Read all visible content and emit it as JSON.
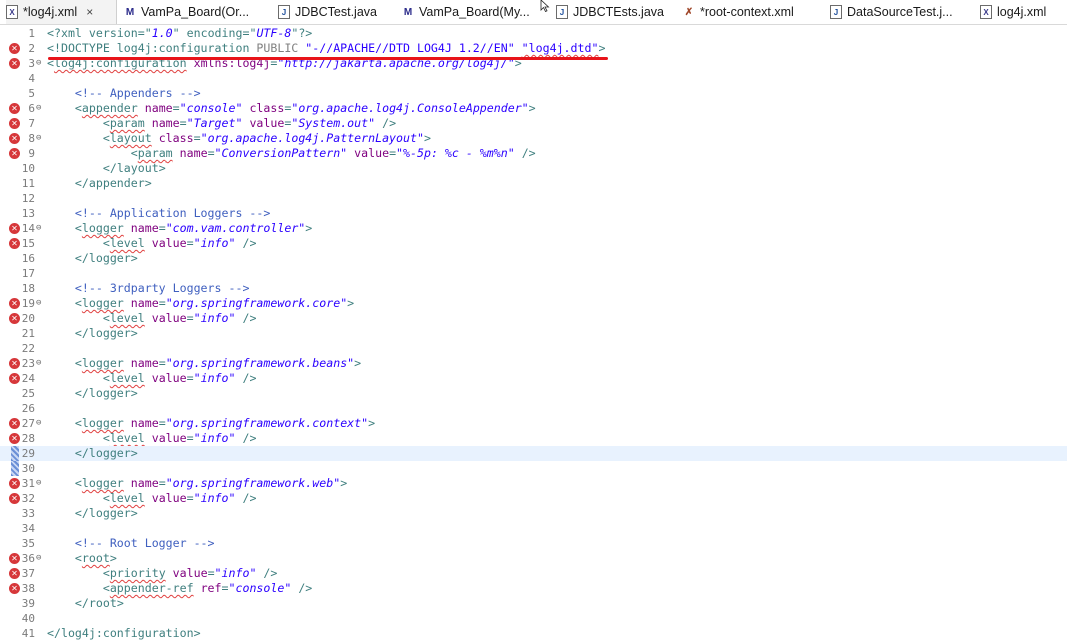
{
  "tabs": [
    {
      "label": "*log4j.xml",
      "icon": "xml-file-icon",
      "active": true,
      "closable": true
    },
    {
      "label": "VamPa_Board(Or...",
      "icon": "mybatis-mapper-icon"
    },
    {
      "label": "JDBCTest.java",
      "icon": "java-file-icon"
    },
    {
      "label": "VamPa_Board(My...",
      "icon": "mybatis-mapper-icon"
    },
    {
      "label": "JDBCTEsts.java",
      "icon": "java-file-icon"
    },
    {
      "label": "*root-context.xml",
      "icon": "spring-context-icon"
    },
    {
      "label": "DataSourceTest.j...",
      "icon": "java-file-icon"
    },
    {
      "label": "log4j.xml",
      "icon": "xml-file-icon"
    }
  ],
  "tab_close_glyph": "×",
  "lines": [
    {
      "n": "1",
      "text": "<?xml version=\"1.0\" encoding=\"UTF-8\"?>"
    },
    {
      "n": "2",
      "text": "<!DOCTYPE log4j:configuration PUBLIC \"-//APACHE//DTD LOG4J 1.2//EN\" \"log4j.dtd\">",
      "error": true
    },
    {
      "n": "3",
      "text": "<log4j:configuration xmlns:log4j=\"http://jakarta.apache.org/log4j/\">",
      "error": true,
      "fold": true
    },
    {
      "n": "4",
      "text": ""
    },
    {
      "n": "5",
      "text": "    <!-- Appenders -->"
    },
    {
      "n": "6",
      "text": "    <appender name=\"console\" class=\"org.apache.log4j.ConsoleAppender\">",
      "error": true,
      "fold": true
    },
    {
      "n": "7",
      "text": "        <param name=\"Target\" value=\"System.out\" />",
      "error": true
    },
    {
      "n": "8",
      "text": "        <layout class=\"org.apache.log4j.PatternLayout\">",
      "error": true,
      "fold": true
    },
    {
      "n": "9",
      "text": "            <param name=\"ConversionPattern\" value=\"%-5p: %c - %m%n\" />",
      "error": true
    },
    {
      "n": "10",
      "text": "        </layout>"
    },
    {
      "n": "11",
      "text": "    </appender>"
    },
    {
      "n": "12",
      "text": ""
    },
    {
      "n": "13",
      "text": "    <!-- Application Loggers -->"
    },
    {
      "n": "14",
      "text": "    <logger name=\"com.vam.controller\">",
      "error": true,
      "fold": true
    },
    {
      "n": "15",
      "text": "        <level value=\"info\" />",
      "error": true
    },
    {
      "n": "16",
      "text": "    </logger>"
    },
    {
      "n": "17",
      "text": ""
    },
    {
      "n": "18",
      "text": "    <!-- 3rdparty Loggers -->"
    },
    {
      "n": "19",
      "text": "    <logger name=\"org.springframework.core\">",
      "error": true,
      "fold": true
    },
    {
      "n": "20",
      "text": "        <level value=\"info\" />",
      "error": true
    },
    {
      "n": "21",
      "text": "    </logger>"
    },
    {
      "n": "22",
      "text": ""
    },
    {
      "n": "23",
      "text": "    <logger name=\"org.springframework.beans\">",
      "error": true,
      "fold": true
    },
    {
      "n": "24",
      "text": "        <level value=\"info\" />",
      "error": true
    },
    {
      "n": "25",
      "text": "    </logger>"
    },
    {
      "n": "26",
      "text": ""
    },
    {
      "n": "27",
      "text": "    <logger name=\"org.springframework.context\">",
      "error": true,
      "fold": true
    },
    {
      "n": "28",
      "text": "        <level value=\"info\" />",
      "error": true
    },
    {
      "n": "29",
      "text": "    </logger>",
      "highlight": true,
      "changed": true
    },
    {
      "n": "30",
      "text": "",
      "changed": true
    },
    {
      "n": "31",
      "text": "    <logger name=\"org.springframework.web\">",
      "error": true,
      "fold": true
    },
    {
      "n": "32",
      "text": "        <level value=\"info\" />",
      "error": true
    },
    {
      "n": "33",
      "text": "    </logger>"
    },
    {
      "n": "34",
      "text": ""
    },
    {
      "n": "35",
      "text": "    <!-- Root Logger -->"
    },
    {
      "n": "36",
      "text": "    <root>",
      "error": true,
      "fold": true
    },
    {
      "n": "37",
      "text": "        <priority value=\"info\" />",
      "error": true
    },
    {
      "n": "38",
      "text": "        <appender-ref ref=\"console\" />",
      "error": true
    },
    {
      "n": "39",
      "text": "    </root>"
    },
    {
      "n": "40",
      "text": ""
    },
    {
      "n": "41",
      "text": "</log4j:configuration>"
    }
  ],
  "error_marker_glyph": "✕",
  "fold_marker_glyph": "⊖",
  "colors": {
    "error": "#d6373a",
    "annotation_underline": "#e8141a",
    "current_line": "#e8f2fe"
  }
}
